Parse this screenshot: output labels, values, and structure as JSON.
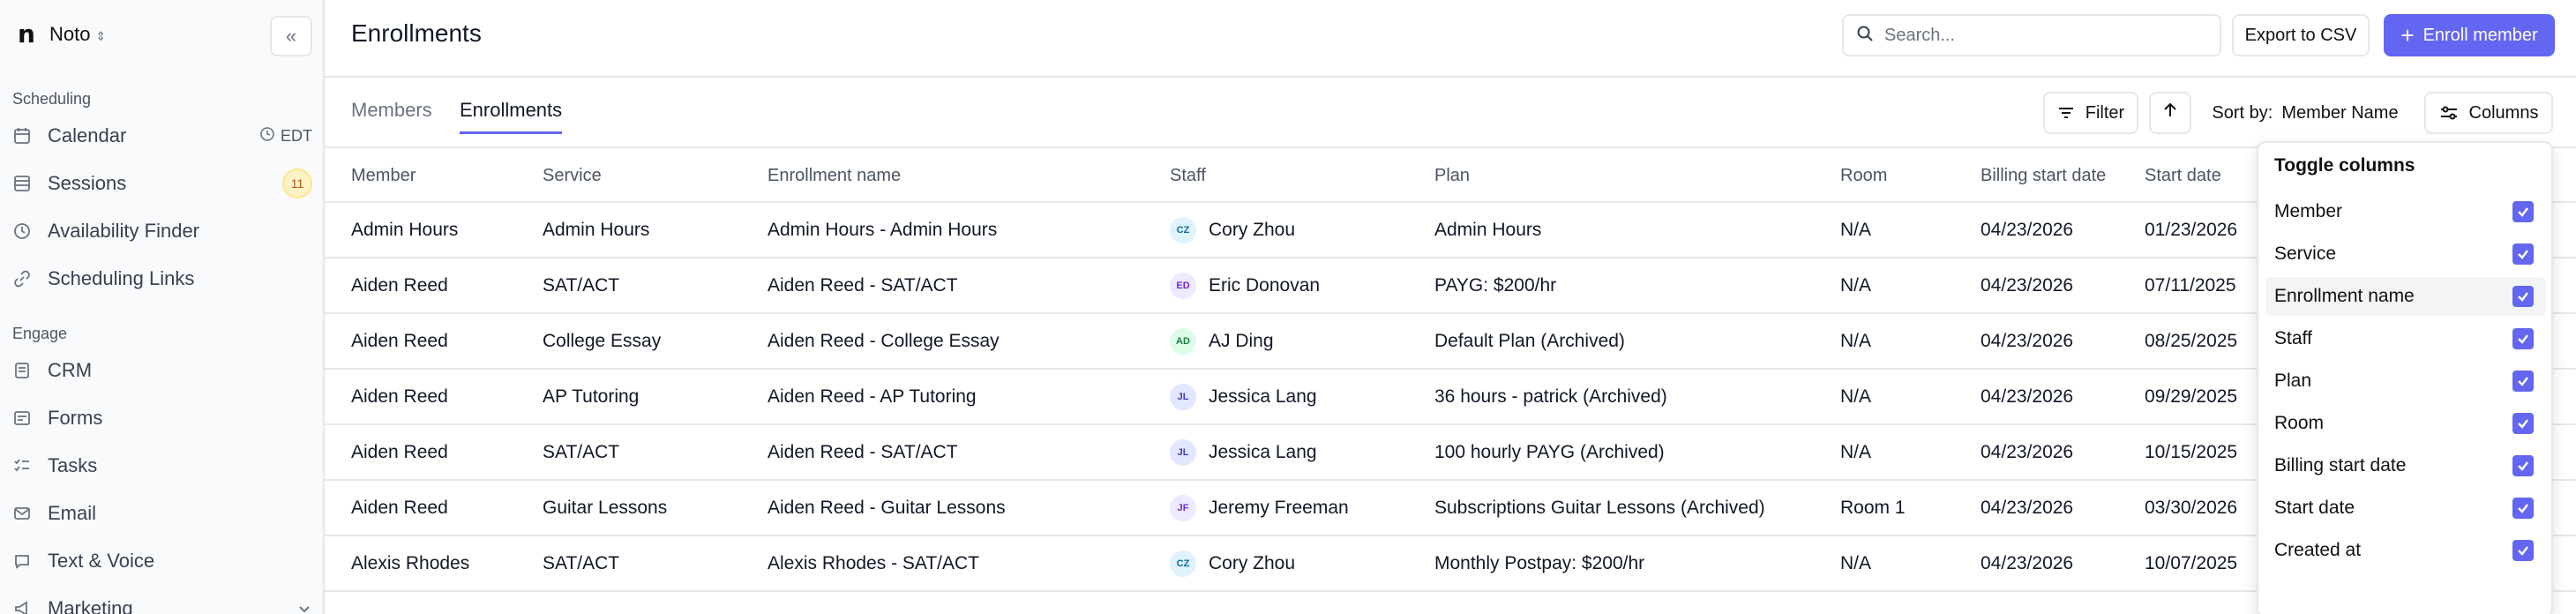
{
  "sidebar": {
    "logo": "n",
    "org_name": "Noto",
    "sections": {
      "scheduling": "Scheduling",
      "engage": "Engage"
    },
    "items": [
      {
        "label": "Calendar",
        "extra": "EDT"
      },
      {
        "label": "Sessions",
        "badge": "11"
      },
      {
        "label": "Availability Finder"
      },
      {
        "label": "Scheduling Links"
      },
      {
        "label": "CRM"
      },
      {
        "label": "Forms"
      },
      {
        "label": "Tasks"
      },
      {
        "label": "Email"
      },
      {
        "label": "Text & Voice"
      },
      {
        "label": "Marketing"
      }
    ]
  },
  "header": {
    "title": "Enrollments",
    "search_placeholder": "Search...",
    "export_label": "Export to CSV",
    "enroll_label": "Enroll member",
    "accent": "#6366f1"
  },
  "tabs": [
    {
      "label": "Members",
      "active": false
    },
    {
      "label": "Enrollments",
      "active": true
    }
  ],
  "toolbar": {
    "filter_label": "Filter",
    "sort_prefix": "Sort by:",
    "sort_value": "Member Name",
    "columns_label": "Columns"
  },
  "table": {
    "columns": [
      "Member",
      "Service",
      "Enrollment name",
      "Staff",
      "Plan",
      "Room",
      "Billing start date",
      "Start date"
    ],
    "rows": [
      {
        "member": "Admin Hours",
        "service": "Admin Hours",
        "enrollment": "Admin Hours - Admin Hours",
        "staff_initials": "CZ",
        "staff": "Cory Zhou",
        "plan": "Admin Hours",
        "room": "N/A",
        "billing": "04/23/2026",
        "start": "01/23/2026"
      },
      {
        "member": "Aiden Reed",
        "service": "SAT/ACT",
        "enrollment": "Aiden Reed - SAT/ACT",
        "staff_initials": "ED",
        "staff": "Eric Donovan",
        "plan": "PAYG: $200/hr",
        "room": "N/A",
        "billing": "04/23/2026",
        "start": "07/11/2025"
      },
      {
        "member": "Aiden Reed",
        "service": "College Essay",
        "enrollment": "Aiden Reed - College Essay",
        "staff_initials": "AD",
        "staff": "AJ Ding",
        "plan": "Default Plan (Archived)",
        "room": "N/A",
        "billing": "04/23/2026",
        "start": "08/25/2025"
      },
      {
        "member": "Aiden Reed",
        "service": "AP Tutoring",
        "enrollment": "Aiden Reed - AP Tutoring",
        "staff_initials": "JL",
        "staff": "Jessica Lang",
        "plan": "36 hours - patrick (Archived)",
        "room": "N/A",
        "billing": "04/23/2026",
        "start": "09/29/2025"
      },
      {
        "member": "Aiden Reed",
        "service": "SAT/ACT",
        "enrollment": "Aiden Reed - SAT/ACT",
        "staff_initials": "JL",
        "staff": "Jessica Lang",
        "plan": "100 hourly PAYG (Archived)",
        "room": "N/A",
        "billing": "04/23/2026",
        "start": "10/15/2025"
      },
      {
        "member": "Aiden Reed",
        "service": "Guitar Lessons",
        "enrollment": "Aiden Reed - Guitar Lessons",
        "staff_initials": "JF",
        "staff": "Jeremy Freeman",
        "plan": "Subscriptions Guitar Lessons (Archived)",
        "room": "Room 1",
        "billing": "04/23/2026",
        "start": "03/30/2026"
      },
      {
        "member": "Alexis Rhodes",
        "service": "SAT/ACT",
        "enrollment": "Alexis Rhodes - SAT/ACT",
        "staff_initials": "CZ",
        "staff": "Cory Zhou",
        "plan": "Monthly Postpay: $200/hr",
        "room": "N/A",
        "billing": "04/23/2026",
        "start": "10/07/2025"
      }
    ]
  },
  "columns_popup": {
    "title": "Toggle columns",
    "items": [
      {
        "label": "Member",
        "checked": true
      },
      {
        "label": "Service",
        "checked": true
      },
      {
        "label": "Enrollment name",
        "checked": true,
        "highlighted": true
      },
      {
        "label": "Staff",
        "checked": true
      },
      {
        "label": "Plan",
        "checked": true
      },
      {
        "label": "Room",
        "checked": true
      },
      {
        "label": "Billing start date",
        "checked": true
      },
      {
        "label": "Start date",
        "checked": true
      },
      {
        "label": "Created at",
        "checked": true
      }
    ]
  }
}
